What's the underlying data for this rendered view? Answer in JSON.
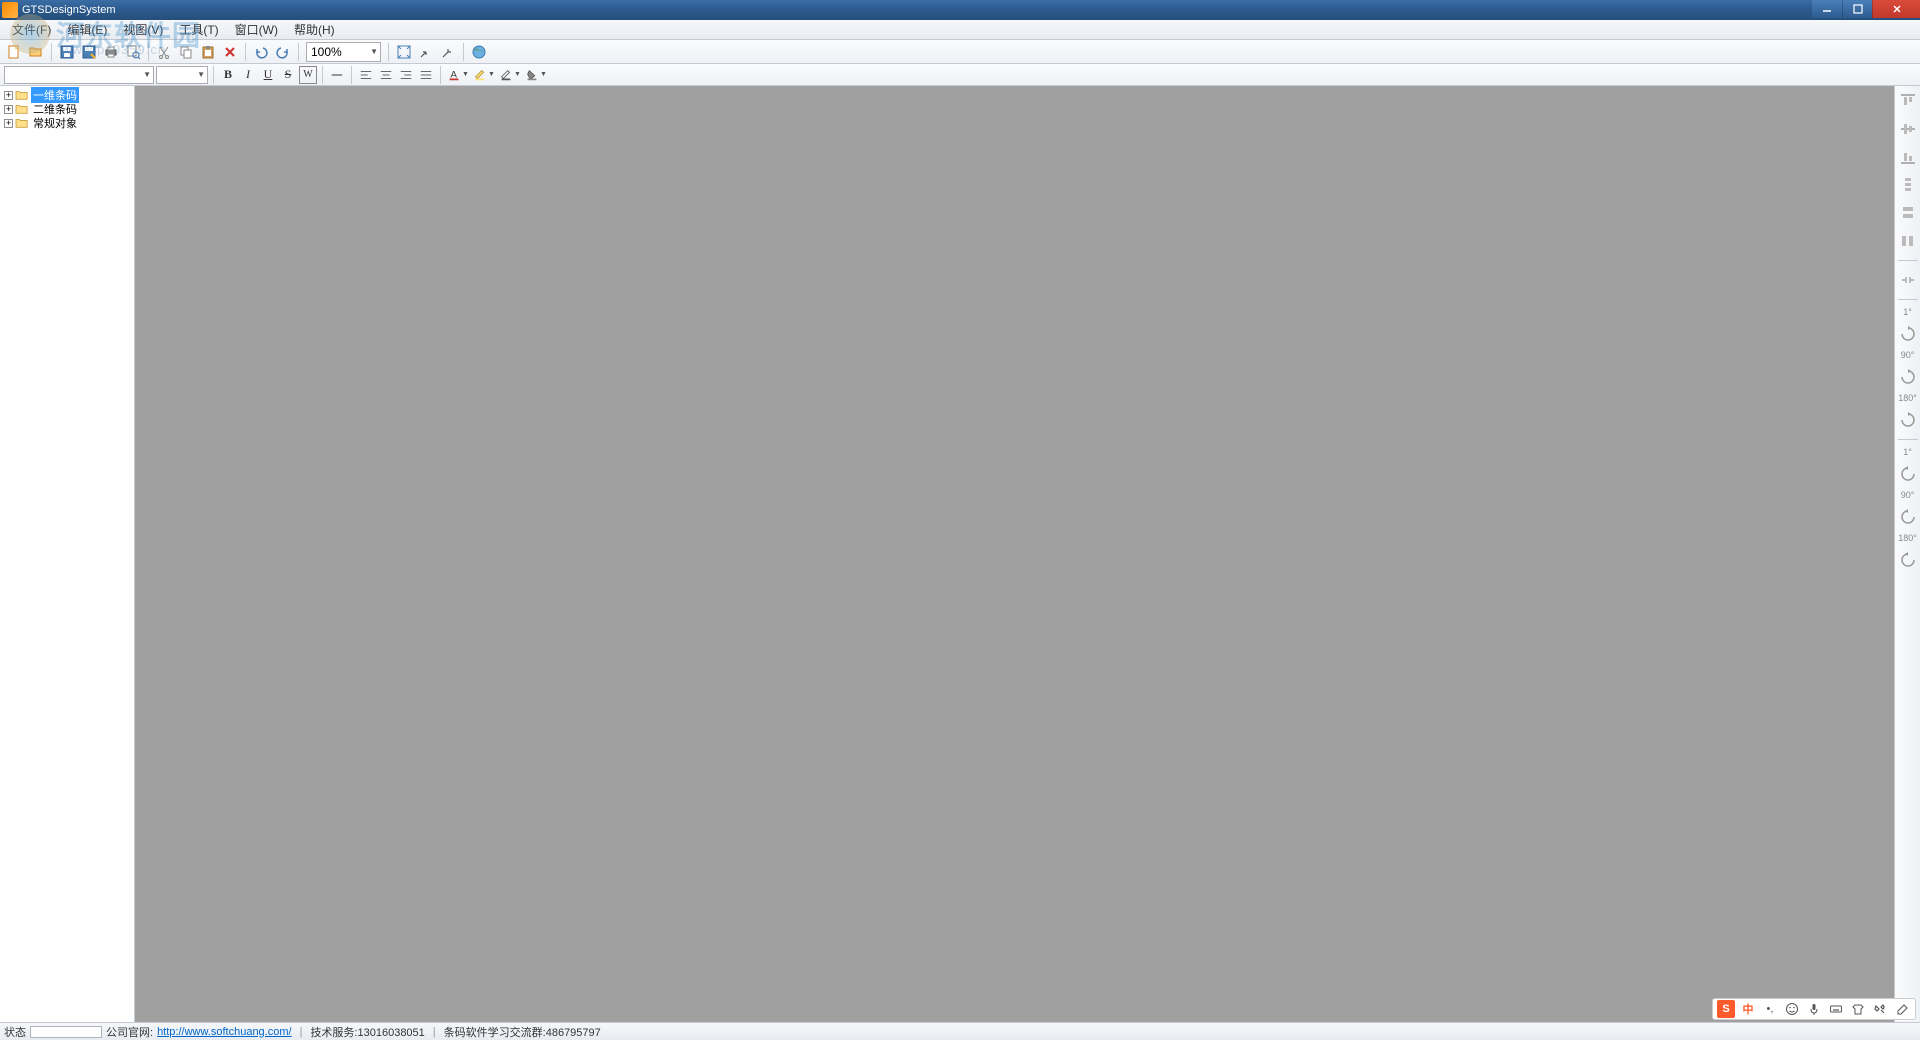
{
  "window": {
    "title": "GTSDesignSystem"
  },
  "menu": {
    "file": "文件(F)",
    "edit": "编辑(E)",
    "view": "视图(V)",
    "tools": "工具(T)",
    "window": "窗口(W)",
    "help": "帮助(H)"
  },
  "toolbar1": {
    "zoom": "100%"
  },
  "toolbar2": {
    "font_family": "",
    "font_size": "",
    "bold": "B",
    "italic": "I",
    "underline": "U",
    "strike": "S",
    "wrap": "W"
  },
  "tree": {
    "items": [
      {
        "label": "一维条码",
        "selected": true
      },
      {
        "label": "二维条码",
        "selected": false
      },
      {
        "label": "常规对象",
        "selected": false
      }
    ]
  },
  "right_toolbar": {
    "rotate_labels": [
      "1°",
      "90°",
      "180°",
      "1°",
      "90°",
      "180°"
    ]
  },
  "statusbar": {
    "status_label": "状态",
    "company_label": "公司官网:",
    "company_url": "http://www.softchuang.com/",
    "tech_support": "技术服务:13016038051",
    "qq_group": "条码软件学习交流群:486795797"
  },
  "ime": {
    "logo": "S",
    "lang": "中"
  },
  "watermark": {
    "text": "河东软件园",
    "sub": "www.pc0359.cn"
  }
}
